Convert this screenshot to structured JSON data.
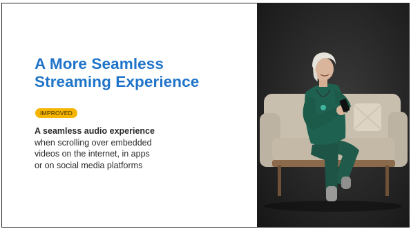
{
  "slide": {
    "title_line1": "A More Seamless",
    "title_line2": "Streaming Experience",
    "badge_label": "IMPROVED",
    "body_bold": "A seamless audio experience",
    "body_line1": "when scrolling over embedded",
    "body_line2": "videos on the internet, in apps",
    "body_line3": "or on social media platforms"
  },
  "colors": {
    "title": "#1f74c9",
    "badge": "#f5b400",
    "text": "#2b2b2b",
    "photo_background": "#262626"
  },
  "icons": {
    "photo": "woman-on-sofa-with-phone-photo"
  }
}
